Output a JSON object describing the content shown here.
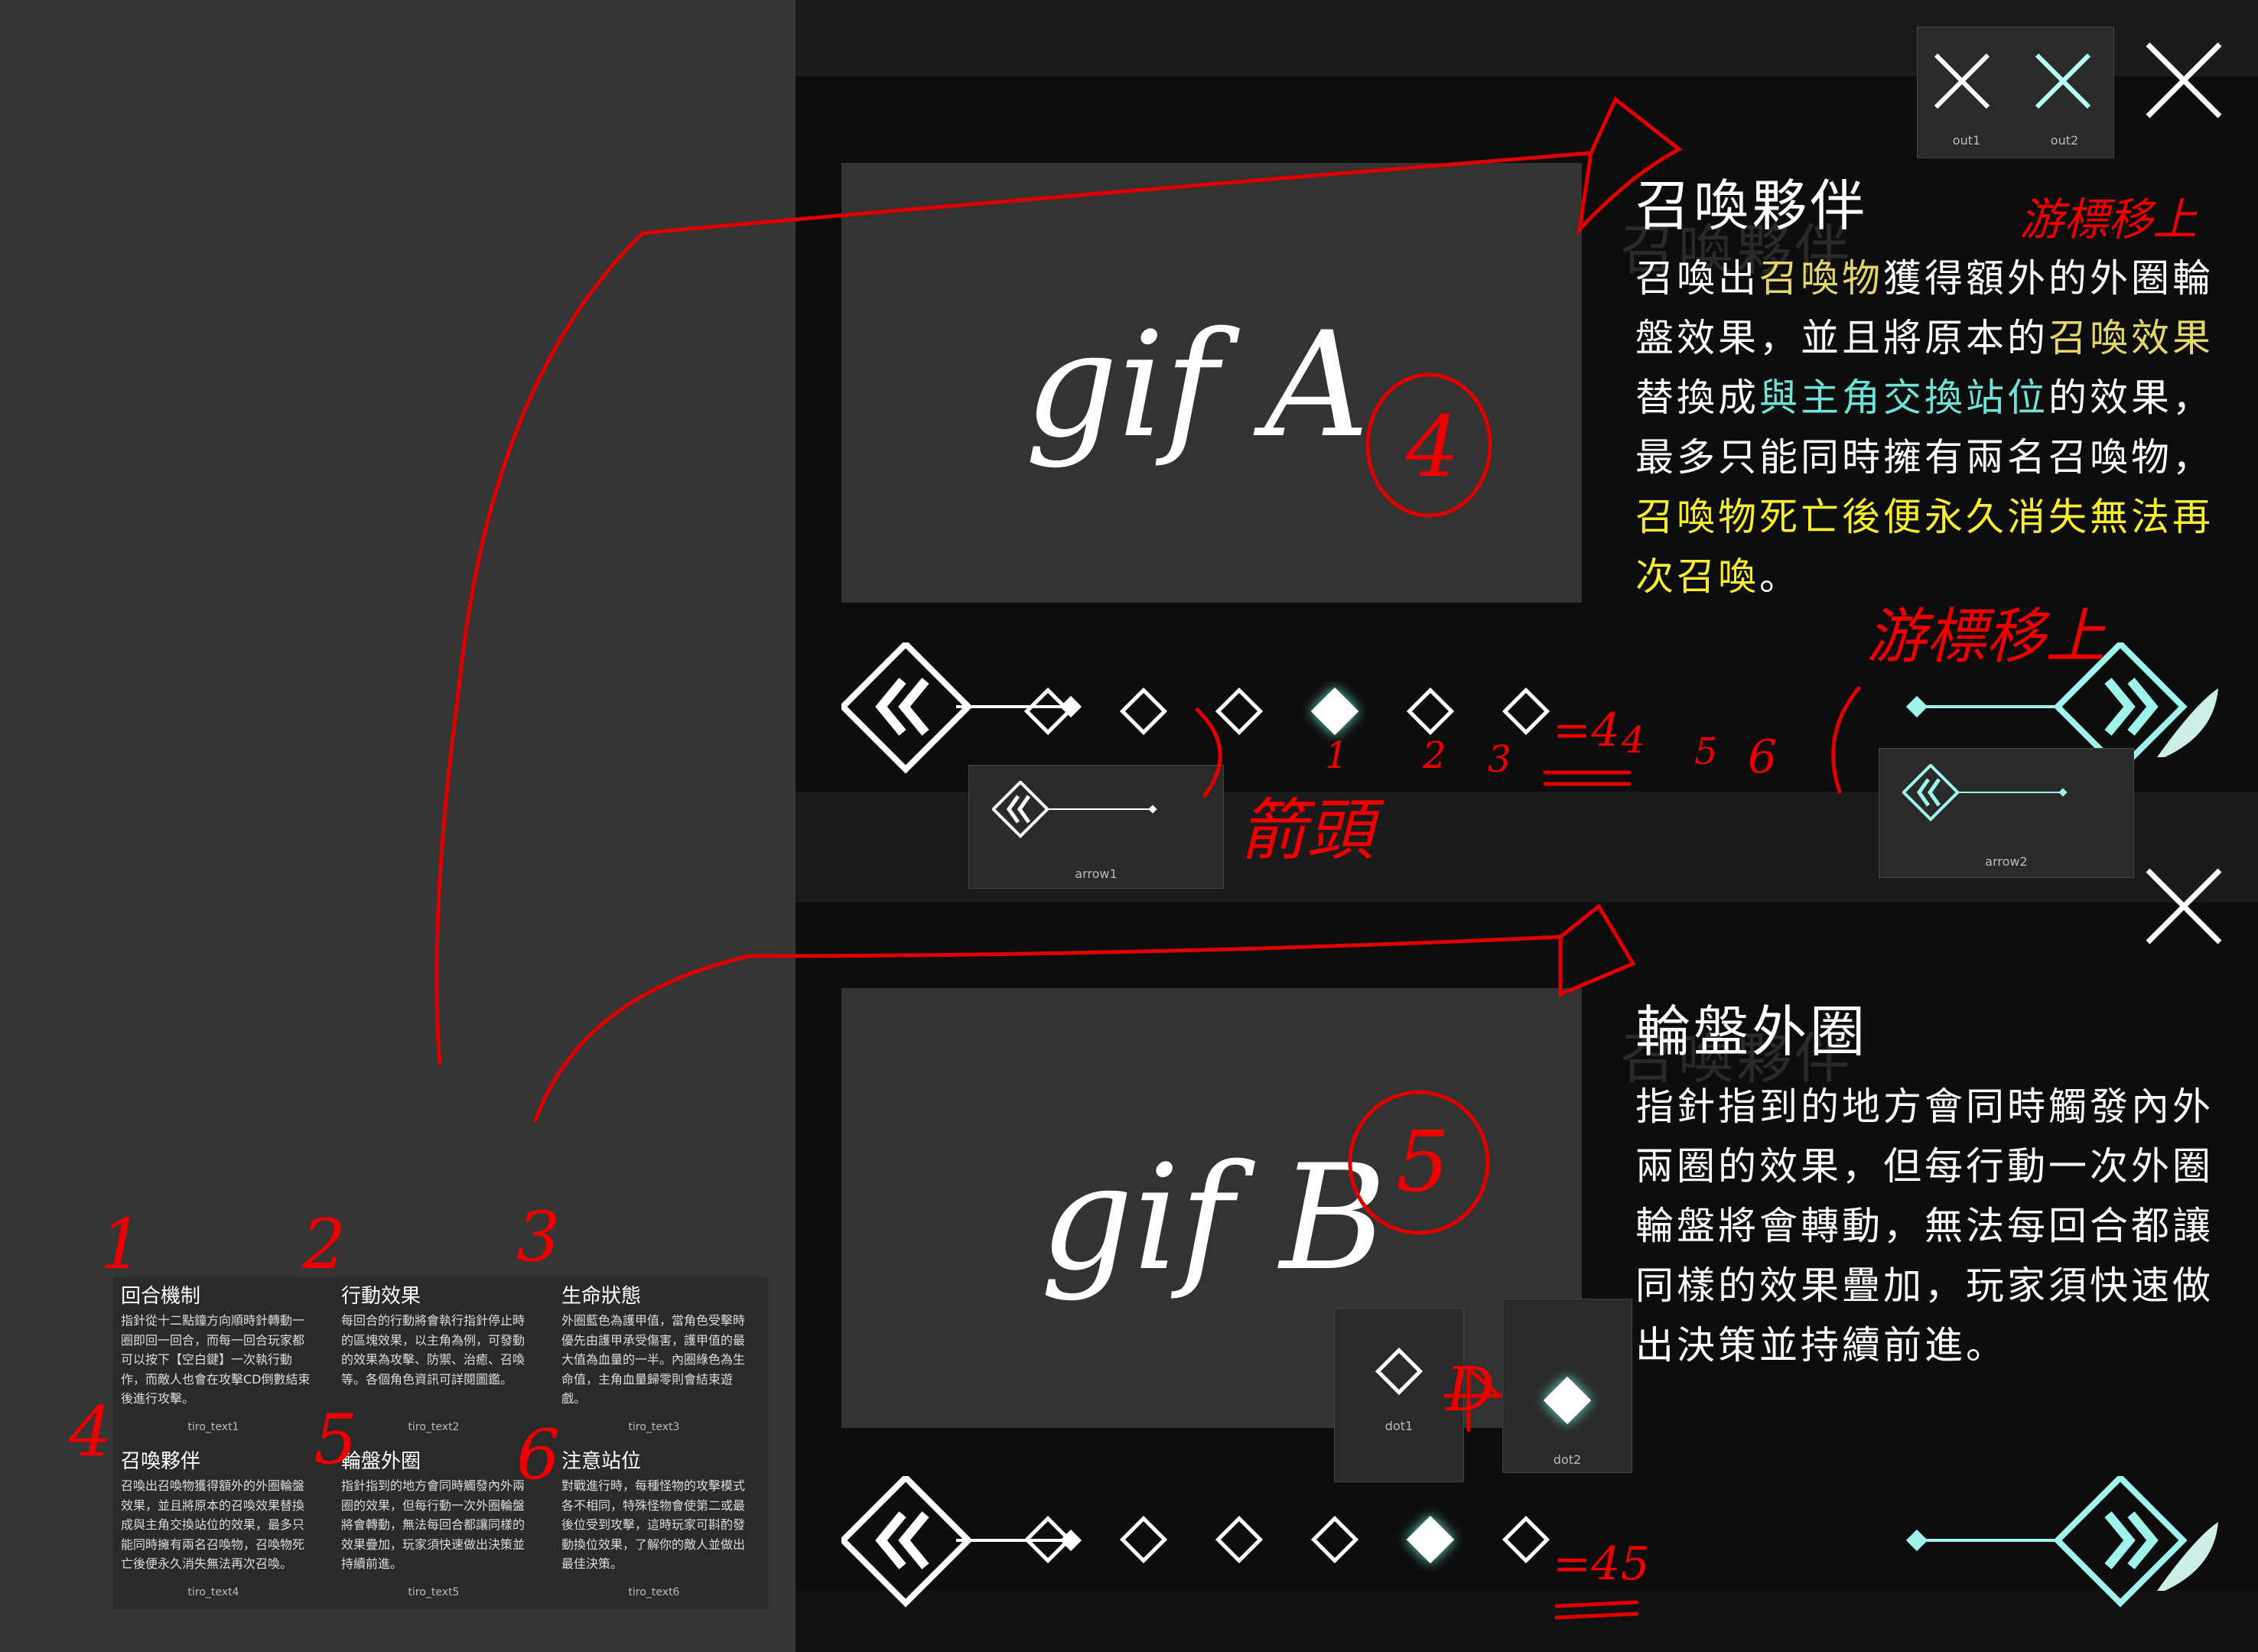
{
  "close_buttons": {
    "out1_label": "out1",
    "out2_label": "out2"
  },
  "panel_a": {
    "gif_label": "gif A",
    "title": "召喚夥伴",
    "ghost_title": "召喚夥伴",
    "body_parts": [
      {
        "text": "召喚出",
        "style": "plain"
      },
      {
        "text": "召喚物",
        "style": "yellow"
      },
      {
        "text": "獲得額外的外圈輪盤效果，並且將原本的",
        "style": "plain"
      },
      {
        "text": "召喚效果",
        "style": "yellow"
      },
      {
        "text": "替換成",
        "style": "plain"
      },
      {
        "text": "與主角交換站位",
        "style": "cyan"
      },
      {
        "text": "的效果，最多只能同時擁有兩名召喚物，",
        "style": "plain"
      },
      {
        "text": "召喚物死亡後便永久消失無法再次召喚",
        "style": "bright"
      },
      {
        "text": "。",
        "style": "plain"
      }
    ],
    "arrow1_label": "arrow1",
    "arrow2_label": "arrow2",
    "active_dot": 4
  },
  "panel_b": {
    "gif_label": "gif B",
    "title": "輪盤外圈",
    "ghost_title": "召喚夥伴",
    "body": "指針指到的地方會同時觸發內外兩圈的效果，但每行動一次外圈輪盤將會轉動，無法每回合都讓同樣的效果疊加，玩家須快速做出決策並持續前進。",
    "dot1_label": "dot1",
    "dot2_label": "dot2",
    "active_dot": 5
  },
  "cards": [
    {
      "title": "回合機制",
      "body": "指針從十二點鐘方向順時針轉動一圈即回一回合，而每一回合玩家都可以按下【空白鍵】一次執行動作，而敵人也會在攻擊CD倒數結束後進行攻擊。",
      "caption": "tiro_text1"
    },
    {
      "title": "行動效果",
      "body": "每回合的行動將會執行指針停止時的區塊效果，以主角為例，可發動的效果為攻擊、防禦、治癒、召喚等。各個角色資訊可詳閱圖鑑。",
      "caption": "tiro_text2"
    },
    {
      "title": "生命狀態",
      "body": "外圈藍色為護甲值，當角色受擊時優先由護甲承受傷害，護甲值的最大值為血量的一半。內圈綠色為生命值，主角血量歸零則會結束遊戲。",
      "caption": "tiro_text3"
    },
    {
      "title": "召喚夥伴",
      "body": "召喚出召喚物獲得額外的外圈輪盤效果，並且將原本的召喚效果替換成與主角交換站位的效果，最多只能同時擁有兩名召喚物，召喚物死亡後便永久消失無法再次召喚。",
      "caption": "tiro_text4"
    },
    {
      "title": "輪盤外圈",
      "body": "指針指到的地方會同時觸發內外兩圈的效果，但每行動一次外圈輪盤將會轉動，無法每回合都讓同樣的效果疊加，玩家須快速做出決策並持續前進。",
      "caption": "tiro_text5"
    },
    {
      "title": "注意站位",
      "body": "對戰進行時，每種怪物的攻擊模式各不相同，特殊怪物會使第二或最後位受到攻擊，這時玩家可斟酌發動換位效果，了解你的敵人並做出最佳決策。",
      "caption": "tiro_text6"
    }
  ],
  "annotations": {
    "hover_note_top": "游標移上",
    "hover_note_mid": "游標移上",
    "arrow_note": "箭頭",
    "circle_a": "4",
    "circle_b": "5",
    "dot_numbers": [
      "1",
      "2",
      "3",
      "4",
      "5",
      "6"
    ],
    "eq_a": "=4",
    "eq_b": "=45",
    "grid_numbers": [
      "1",
      "2",
      "3",
      "4",
      "5",
      "6"
    ],
    "d_letter": "D"
  },
  "colors": {
    "annotation_red": "#e00000",
    "accent_cyan": "#6ee3d8",
    "highlight_yellow": "#e4d66a",
    "highlight_bright": "#f7ee2e"
  }
}
